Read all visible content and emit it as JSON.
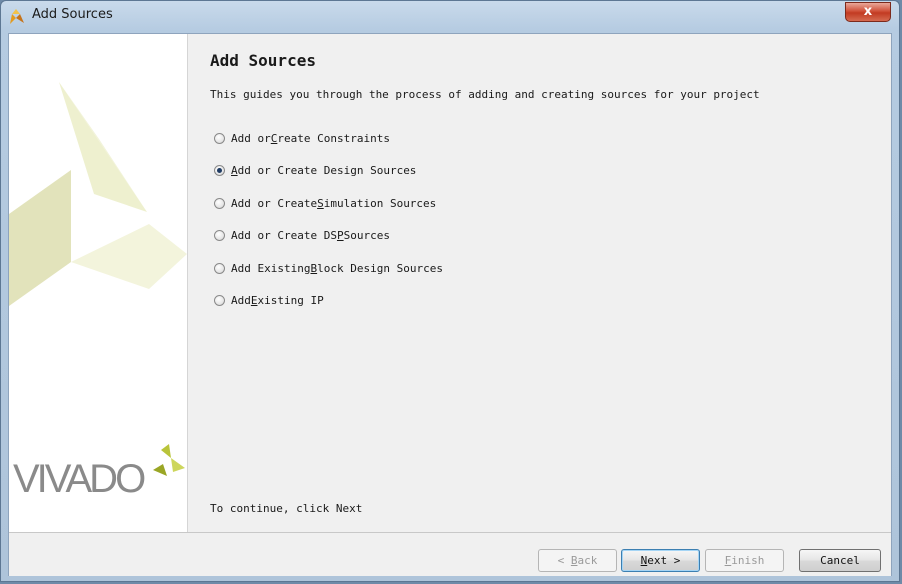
{
  "window": {
    "title": "Add Sources",
    "close_label": "x"
  },
  "sidebar": {
    "logo_text": "VIVADO",
    "logo_mark": "."
  },
  "main": {
    "heading": "Add Sources",
    "description": "This guides you through the process of adding and creating sources for your project",
    "options": [
      {
        "pre": "Add or ",
        "mnemonic": "C",
        "post": "reate Constraints",
        "selected": false
      },
      {
        "pre": "",
        "mnemonic": "A",
        "post": "dd or Create Design Sources",
        "selected": true
      },
      {
        "pre": "Add or Create ",
        "mnemonic": "S",
        "post": "imulation Sources",
        "selected": false
      },
      {
        "pre": "Add or Create DS",
        "mnemonic": "P",
        "post": " Sources",
        "selected": false
      },
      {
        "pre": "Add Existing ",
        "mnemonic": "B",
        "post": "lock Design Sources",
        "selected": false
      },
      {
        "pre": "Add ",
        "mnemonic": "E",
        "post": "xisting IP",
        "selected": false
      }
    ],
    "continue_hint": "To continue, click Next"
  },
  "buttons": {
    "back": {
      "arrow": "<",
      "mnemonic": "B",
      "rest": "ack"
    },
    "next": {
      "mnemonic": "N",
      "rest": "ext",
      "arrow": ">"
    },
    "finish": {
      "mnemonic": "F",
      "rest": "inish"
    },
    "cancel": "Cancel"
  },
  "colors": {
    "accent": "#1f3b63",
    "logo_green": "#b9c43a",
    "watermark": "#eef0cf"
  }
}
